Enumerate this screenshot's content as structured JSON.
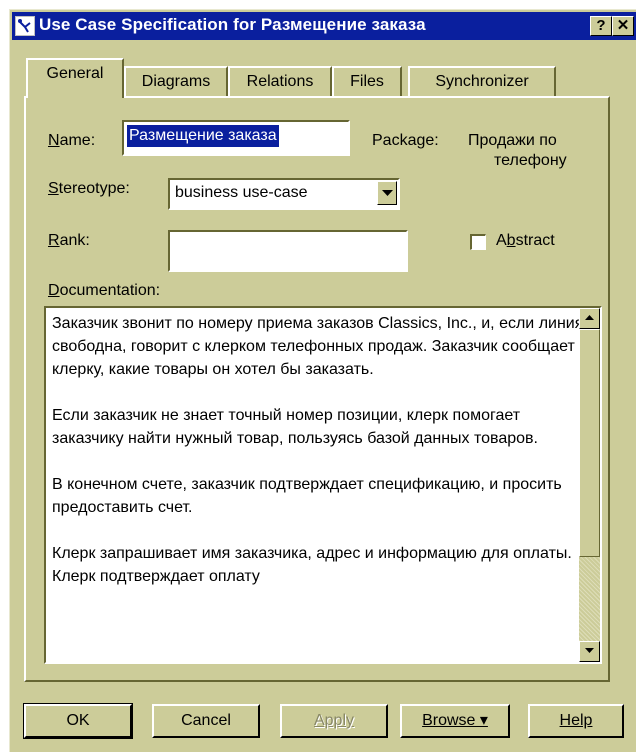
{
  "window": {
    "title": "Use Case Specification for Размещение заказа",
    "help_button": "?",
    "close_button": "✕"
  },
  "tabs": [
    {
      "label": "General",
      "active": true
    },
    {
      "label": "Diagrams",
      "active": false
    },
    {
      "label": "Relations",
      "active": false
    },
    {
      "label": "Files",
      "active": false
    },
    {
      "label": "Synchronizer",
      "active": false
    }
  ],
  "general": {
    "name_label": "Name:",
    "name_value": "Размещение заказа",
    "package_label": "Package:",
    "package_value_line1": "Продажи по",
    "package_value_line2": "телефону",
    "stereotype_label": "Stereotype:",
    "stereotype_value": "business use-case",
    "rank_label": "Rank:",
    "rank_value": "",
    "abstract_label": "Abstract",
    "abstract_checked": false,
    "documentation_label": "Documentation:",
    "documentation_paragraphs": [
      "Заказчик звонит по номеру приема заказов Classics, Inc., и, если линия свободна, говорит с клерком телефонных продаж. Заказчик сообщает клерку, какие товары он хотел бы заказать.",
      "Если заказчик не знает точный номер позиции,  клерк помогает заказчику найти нужный товар, пользуясь базой данных товаров.",
      "В конечном счете, заказчик подтверждает спецификацию, и просить предоставить счет.",
      "Клерк запрашивает имя заказчика, адрес и информацию для оплаты. Клерк подтверждает оплату"
    ]
  },
  "buttons": {
    "ok": "OK",
    "cancel": "Cancel",
    "apply": "Apply",
    "browse": "Browse ▾",
    "help": "Help"
  },
  "colors": {
    "face": "#cccc99",
    "title_bar": "#0a1f9e",
    "selection": "#0a1f9e"
  }
}
